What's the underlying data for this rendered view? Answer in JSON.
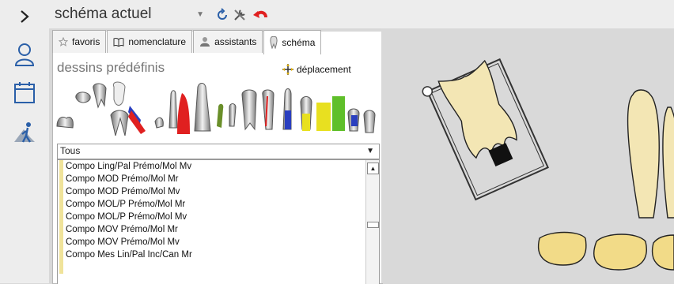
{
  "toolbar": {
    "schema_select_value": "schéma actuel"
  },
  "tabs": [
    {
      "label": "favoris",
      "icon": "star-icon"
    },
    {
      "label": "nomenclature",
      "icon": "book-icon"
    },
    {
      "label": "assistants",
      "icon": "assistant-icon"
    },
    {
      "label": "schéma",
      "icon": "tooth-icon"
    }
  ],
  "panel": {
    "section_title": "dessins prédéfinis",
    "move_label": "déplacement",
    "filter_value": "Tous"
  },
  "list": {
    "items": [
      "Compo Ling/Pal Prémo/Mol Mv",
      "Compo MOD Prémo/Mol Mr",
      "Compo MOD Prémo/Mol Mv",
      "Compo MOL/P Prémo/Mol Mr",
      "Compo MOL/P Prémo/Mol Mv",
      "Compo MOV Prémo/Mol Mr",
      "Compo MOV Prémo/Mol Mv",
      "Compo Mes Lin/Pal Inc/Can Mr"
    ]
  },
  "colors": {
    "accent_red": "#e02020",
    "tooth_fill": "#f3e6b4",
    "list_marker": "#f0e39a"
  }
}
